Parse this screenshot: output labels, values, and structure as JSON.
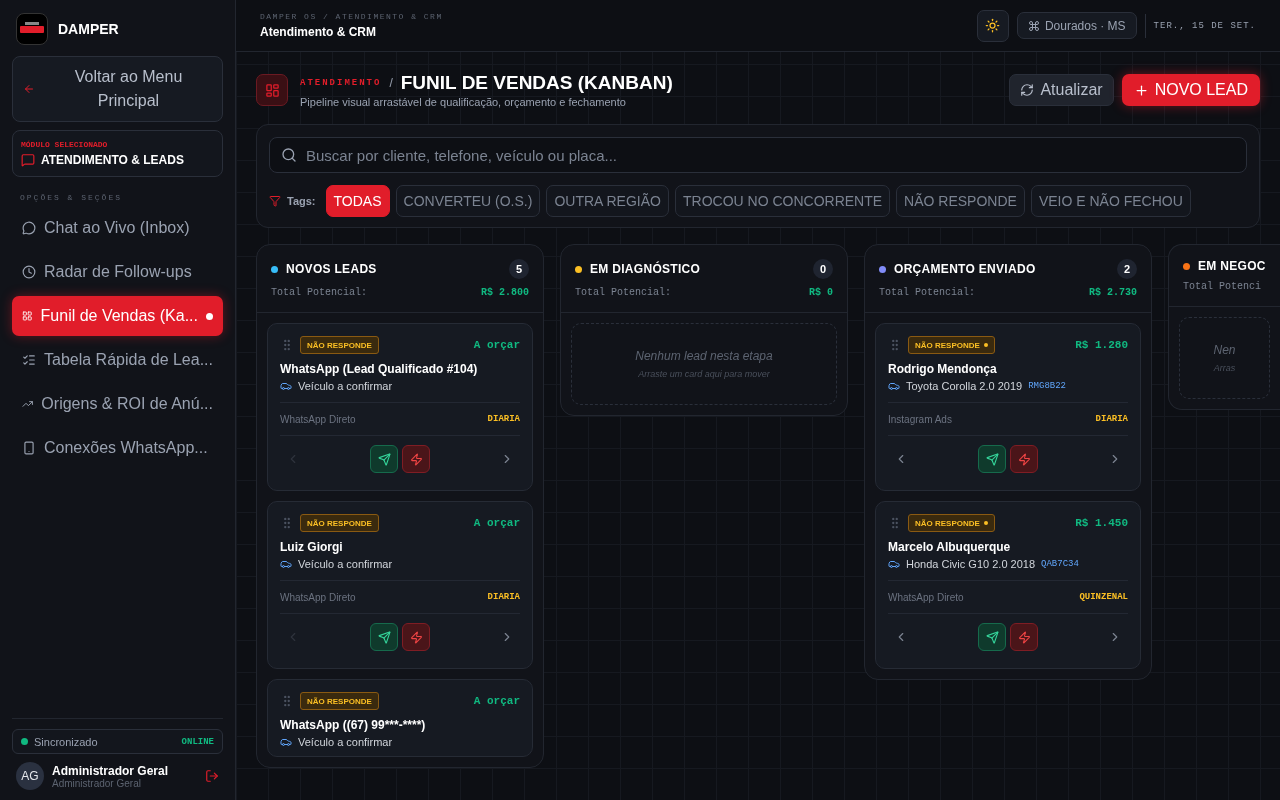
{
  "sidebar": {
    "brand": "DAMPER",
    "back_button": "Voltar ao Menu Principal",
    "module": {
      "label": "MÓDULO SELECIONADO",
      "name": "ATENDIMENTO & LEADS"
    },
    "section_title": "OPÇÕES & SEÇÕES",
    "items": [
      {
        "label": "Chat ao Vivo (Inbox)",
        "selected": false
      },
      {
        "label": "Radar de Follow-ups",
        "selected": false
      },
      {
        "label": "Funil de Vendas (Ka...",
        "selected": true
      },
      {
        "label": "Tabela Rápida de Lea...",
        "selected": false
      },
      {
        "label": "Origens & ROI de Anú...",
        "selected": false
      },
      {
        "label": "Conexões WhatsApp...",
        "selected": false
      }
    ],
    "sync": {
      "label": "Sincronizado",
      "status": "ONLINE"
    },
    "user": {
      "initials": "AG",
      "name": "Administrador Geral",
      "role": "Administrador Geral"
    }
  },
  "topbar": {
    "breadcrumb": "DAMPER OS / ATENDIMENTO & CRM",
    "title": "Atendimento & CRM",
    "location": "Dourados · MS",
    "date": "TER., 15 DE SET."
  },
  "page": {
    "section": "ATENDIMENTO",
    "separator": "/",
    "title": "FUNIL DE VENDAS (KANBAN)",
    "subtitle": "Pipeline visual arrastável de qualificação, orçamento e fechamento",
    "refresh_button": "Atualizar",
    "new_button": "NOVO LEAD"
  },
  "filters": {
    "search_placeholder": "Buscar por cliente, telefone, veículo ou placa...",
    "tags_label": "Tags:",
    "tags": [
      {
        "label": "TODAS",
        "selected": true
      },
      {
        "label": "CONVERTEU (O.S.)",
        "selected": false
      },
      {
        "label": "OUTRA REGIÃO",
        "selected": false
      },
      {
        "label": "TROCOU NO CONCORRENTE",
        "selected": false
      },
      {
        "label": "NÃO RESPONDE",
        "selected": false
      },
      {
        "label": "VEIO E NÃO FECHOU",
        "selected": false
      }
    ]
  },
  "columns": [
    {
      "title": "NOVOS LEADS",
      "color": "#38bdf8",
      "cut": false,
      "count": "5",
      "total_label": "Total Potencial:",
      "total": "R$ 2.800",
      "cards": [
        {
          "tag": "NÃO RESPONDE",
          "flag": false,
          "value": "A orçar",
          "name": "WhatsApp (Lead Qualificado #104)",
          "vehicle": "Veículo a confirmar",
          "source": "WhatsApp Direto",
          "frequency": "DIARIA",
          "prev_enabled": false,
          "partial": false
        },
        {
          "tag": "NÃO RESPONDE",
          "flag": false,
          "value": "A orçar",
          "name": "Luiz Giorgi",
          "vehicle": "Veículo a confirmar",
          "source": "WhatsApp Direto",
          "frequency": "DIARIA",
          "prev_enabled": false,
          "partial": false
        },
        {
          "tag": "NÃO RESPONDE",
          "flag": false,
          "value": "A orçar",
          "name": "WhatsApp ((67) 99***-****)",
          "vehicle": "Veículo a confirmar",
          "partial": true
        }
      ]
    },
    {
      "title": "EM DIAGNÓSTICO",
      "color": "#fbbf24",
      "cut": false,
      "count": "0",
      "total_label": "Total Potencial:",
      "total": "R$ 0",
      "empty": {
        "title": "Nenhum lead nesta etapa",
        "hint": "Arraste um card aqui para mover"
      }
    },
    {
      "title": "ORÇAMENTO ENVIADO",
      "color": "#818cf8",
      "cut": false,
      "count": "2",
      "total_label": "Total Potencial:",
      "total": "R$ 2.730",
      "cards": [
        {
          "tag": "NÃO RESPONDE",
          "flag": true,
          "value": "R$ 1.280",
          "name": "Rodrigo Mendonça",
          "vehicle": "Toyota Corolla 2.0 2019",
          "plate": "RMG8B22",
          "source": "Instagram Ads",
          "frequency": "DIARIA",
          "prev_enabled": true,
          "partial": false
        },
        {
          "tag": "NÃO RESPONDE",
          "flag": true,
          "value": "R$ 1.450",
          "name": "Marcelo Albuquerque",
          "vehicle": "Honda Civic G10 2.0 2018",
          "plate": "QAB7C34",
          "source": "WhatsApp Direto",
          "frequency": "QUINZENAL",
          "prev_enabled": true,
          "partial": false
        }
      ]
    },
    {
      "title": "EM NEGOC",
      "color": "#f97316",
      "total_label": "Total Potenci",
      "cut": true,
      "empty": {
        "title": "Nen",
        "hint": "Arras"
      }
    }
  ]
}
